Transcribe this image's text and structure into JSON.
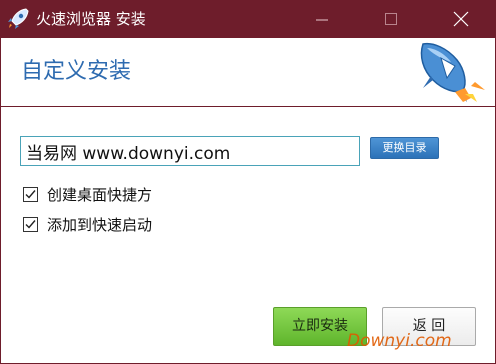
{
  "window": {
    "title": "火速浏览器 安装",
    "titlebar_color": "#6e1d2b",
    "controls": {
      "minimize": "minimize-icon",
      "maximize": "maximize-icon",
      "close": "close-icon"
    }
  },
  "header": {
    "title": "自定义安装",
    "title_color": "#2e6bb0",
    "logo_icon": "rocket-icon"
  },
  "install_path": {
    "value": "当易网 www.downyi.com",
    "browse_label": "更换目录"
  },
  "options": [
    {
      "label": "创建桌面快捷方",
      "checked": true
    },
    {
      "label": "添加到快速启动",
      "checked": true
    }
  ],
  "buttons": {
    "install_label": "立即安装",
    "back_label": "返 回",
    "install_color": "#6cc13a"
  },
  "watermark": "Downyi.com"
}
